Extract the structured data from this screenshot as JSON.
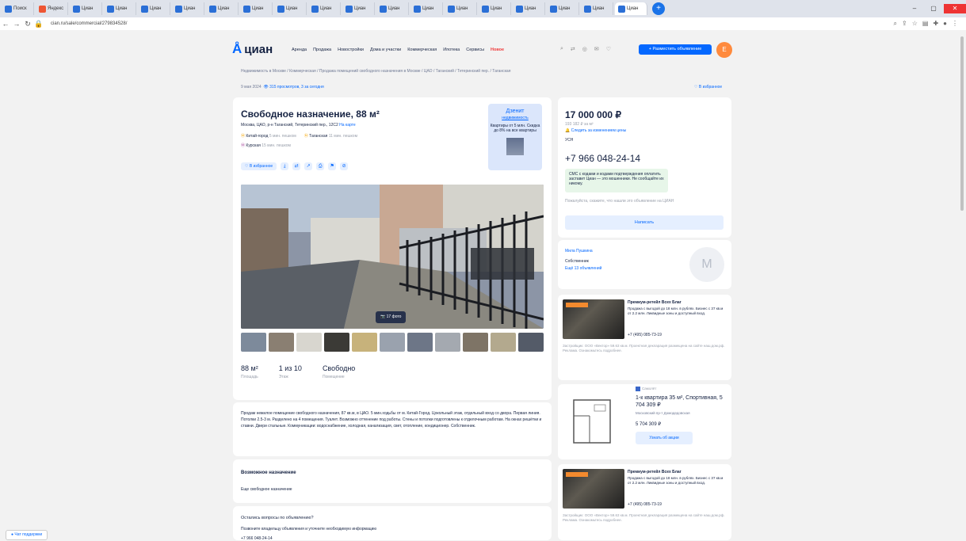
{
  "browser": {
    "tabs": [
      "Поиск",
      "Яндекс",
      "Циан",
      "Циан",
      "Циан",
      "Циан",
      "Циан",
      "Циан",
      "Циан",
      "Циан",
      "Циан",
      "Циан",
      "Циан",
      "Циан",
      "Циан",
      "Циан",
      "Циан",
      "Циан",
      "Циан",
      "Циан"
    ],
    "url": "cian.ru/sale/commercial/279834528/"
  },
  "header": {
    "logo_text": "циан",
    "nav": [
      "Аренда",
      "Продажа",
      "Новостройки",
      "Дома и участки",
      "Коммерческая",
      "Ипотека",
      "Сервисы",
      "Новое"
    ],
    "post_button": "+ Разместить объявление",
    "avatar_letter": "Е"
  },
  "breadcrumbs": "Недвижимость в Москве / Коммерческая / Продажа помещений свободного назначения в Москве / ЦАО / Таганский / Тетеринский пер. / Таганская",
  "meta": {
    "date": "9 мая 2024",
    "views": "315 просмотров, 3 за сегодня",
    "favorite": "В избранное"
  },
  "listing": {
    "title": "Свободное назначение, 88 м²",
    "address": "Москва, ЦАО, р-н Таганский, Тетеринский пер., 12С2",
    "map_link": "На карте",
    "metro1": {
      "name": "Китай-город",
      "time": "5 мин. пешком"
    },
    "metro2": {
      "name": "Таганская",
      "time": "11 мин. пешком"
    },
    "metro3": {
      "name": "Курская",
      "time": "15 мин. пешком"
    },
    "favorite_button": "В избранное",
    "photo_count": "17 фото",
    "promo": {
      "head": "Дзенит",
      "sub": "недвижимость",
      "sub2": "Квартиры от 5 млн. Скидка до 8% на все квартиры"
    },
    "stats": [
      {
        "value": "88 м²",
        "label": "Площадь"
      },
      {
        "value": "1 из 10",
        "label": "Этаж"
      },
      {
        "value": "Свободно",
        "label": "Помещение"
      }
    ],
    "description": "Продам нежилое помещение свободного назначения, 87 кв.м, в ЦАО. 5 мин.ходьбы от м. Китай-Город. Цокольный этаж, отдельный вход со двора. Первая линия. Потолки 2.5-3 м. Разделено на 4 помещения. Туалет. Возможно оттенение под работы. Стены и потолки подготовлены к отделочным работам. На окнах решётки и ставни. Двери стальные. Коммуникации: водоснабжение, холодная, канализация, свет, отопление, кондиционер. Собственник.",
    "purpose_heading": "Возможное назначение",
    "purpose_text": "Еще свободное назначение",
    "question_heading": "Остались вопросы по объявлению?",
    "question_text": "Позвоните владельцу объявления и уточните необходимую информацию",
    "question_phone": "+7 966 048-24-14"
  },
  "price": {
    "value": "17 000 000 ₽",
    "per_m2": "193 182 ₽ за м²",
    "watch": "Следить за изменением цены",
    "tax": "УСН",
    "phone": "+7 966 048-24-14",
    "warning": "СМС с кодами и кодами подтверждения оплатить заставит Циан — это мошенники. Не сообщайте их никому.",
    "note": "Пожалуйста, скажите, что нашли это объявление на ЦИАН",
    "write_button": "Написать"
  },
  "owner": {
    "name": "Мила Пушкина",
    "role": "Собственник",
    "since": "Ещё 13 объявлений",
    "avatar_letter": "М"
  },
  "ads": [
    {
      "title": "Премиум-ретейл Всех Благ",
      "text": "Продажа с выгодой до 18 млн. в рублях. Бизнес с 37 кв.м от 2.2 млн. Ликвидные зоны и доступный вход.",
      "phone": "+7 (495) 085-73-19",
      "foot": "Застройщик: ООО «Вектор» 59.63 кв.м. Проектная декларация размещена на сайте наш.дом.рф. Реклама. Ознакомьтесь подробнее."
    },
    {
      "brand": "Самолёт",
      "title": "1-к квартира 35 м², Спортивная, 5 704 309 ₽",
      "sub": "Московский пр-т Домодедовская",
      "price": "5 704 309 ₽",
      "cta": "Узнать об акции"
    },
    {
      "title": "Премиум-ретейл Всех Благ",
      "text": "Продажа с выгодой до 18 млн. в рублях. Бизнес с 37 кв.м от 2.2 млн. Ликвидные зоны и доступный вход.",
      "phone": "+7 (495) 085-73-19",
      "foot": "Застройщик: ООО «Вектор» 59.63 кв.м. Проектная декларация размещена на сайте наш.дом.рф. Реклама. Ознакомьтесь подробнее."
    }
  ],
  "help_button": "Чат поддержки",
  "colors": {
    "accent": "#0468ff",
    "orange": "#ff8a3d",
    "text": "#152242"
  }
}
